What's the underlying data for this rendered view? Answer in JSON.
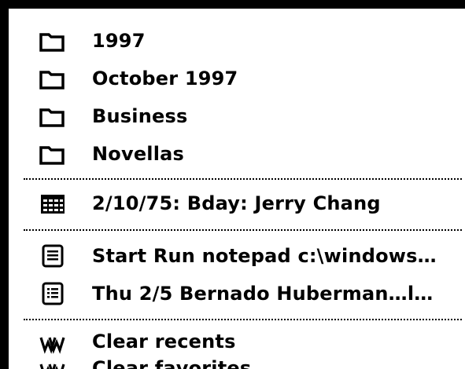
{
  "menu": {
    "folders": [
      {
        "label": "1997",
        "icon": "folder-icon"
      },
      {
        "label": "October 1997",
        "icon": "folder-icon"
      },
      {
        "label": "Business",
        "icon": "folder-icon"
      },
      {
        "label": "Novellas",
        "icon": "folder-icon"
      }
    ],
    "dates": [
      {
        "label": "2/10/75: Bday: Jerry Chang",
        "icon": "calendar-icon"
      }
    ],
    "documents": [
      {
        "label": "Start Run notepad c:\\windows…",
        "icon": "note-icon"
      },
      {
        "label": "Thu 2/5 Bernado Huberman…l…",
        "icon": "list-note-icon"
      }
    ],
    "actions": [
      {
        "label": "Clear recents",
        "icon": "clear-icon"
      },
      {
        "label": "Clear favorites",
        "icon": "clear-icon"
      }
    ]
  },
  "colors": {
    "foreground": "#000000",
    "background": "#ffffff"
  }
}
